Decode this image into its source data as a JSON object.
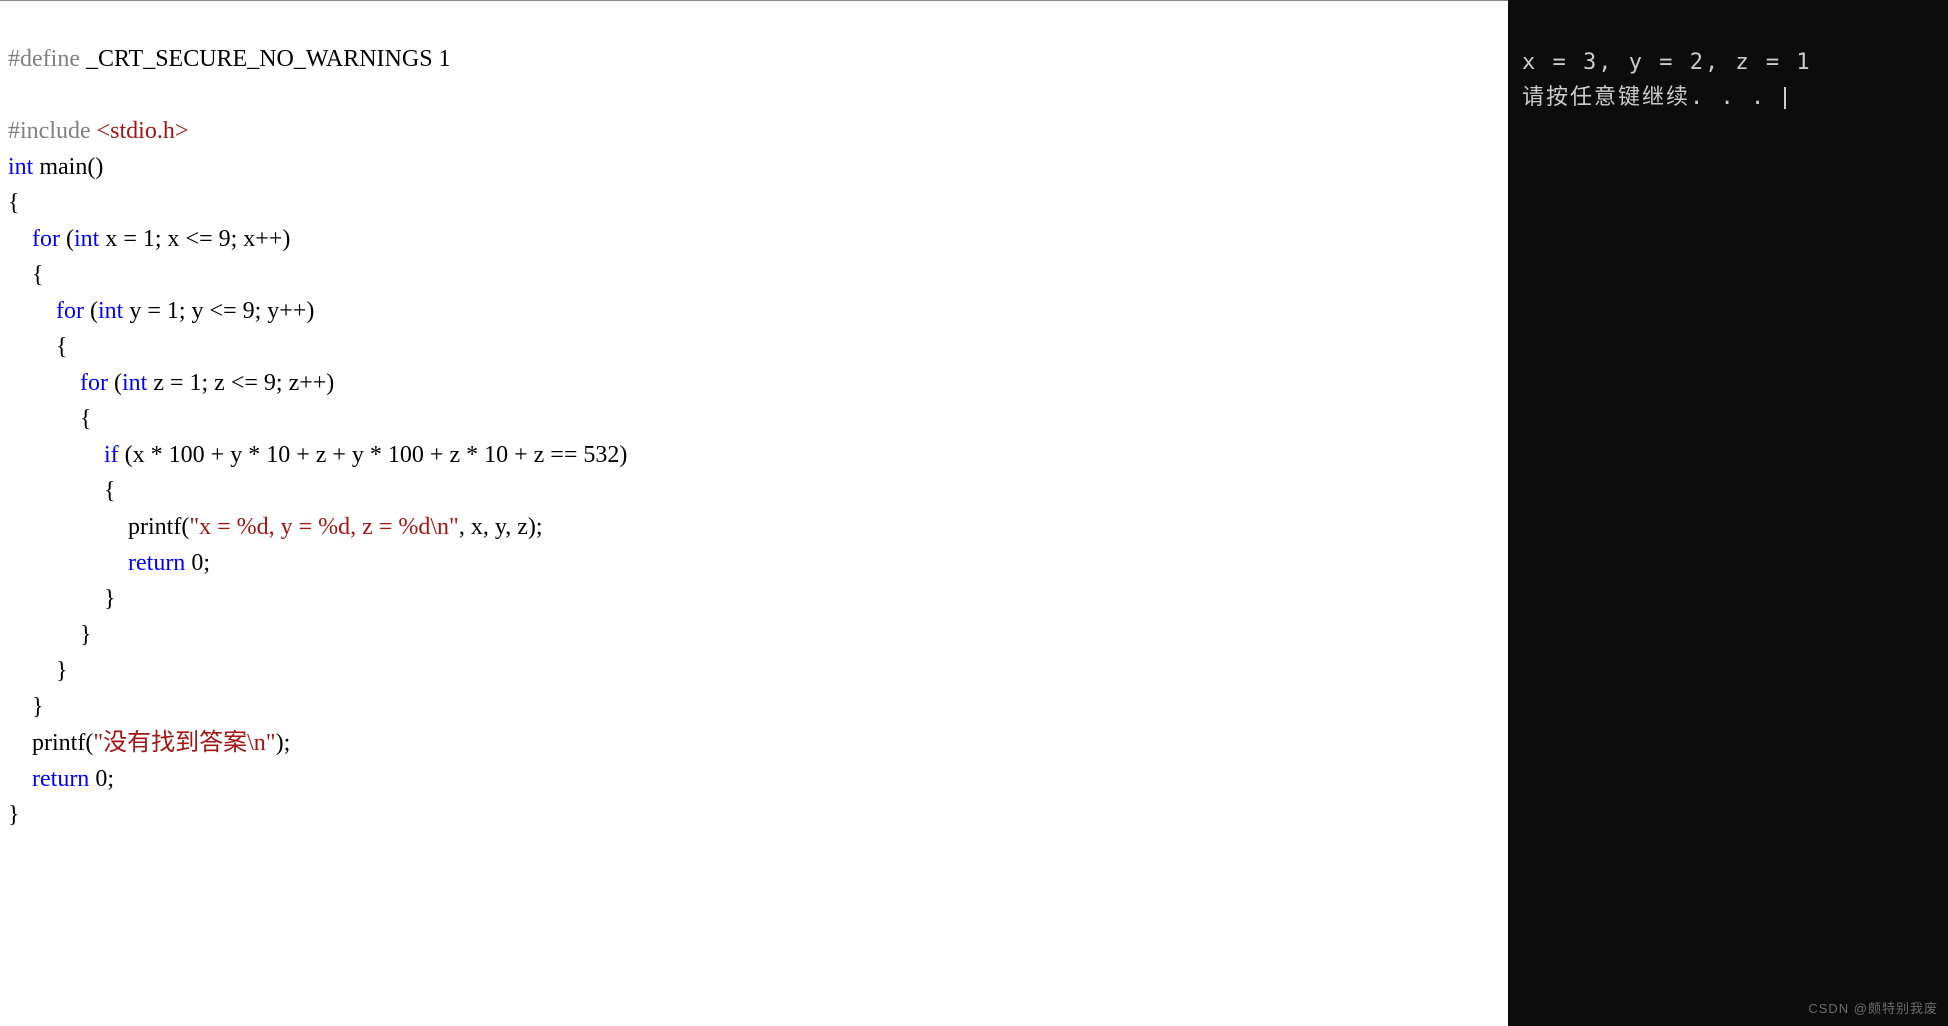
{
  "editor": {
    "line1_prefix": "#define",
    "line1_rest": " _CRT_SECURE_NO_WARNINGS 1",
    "line3a": "#include",
    "line3b": " <stdio.h>",
    "line4_int": "int",
    "line4_main": " main()",
    "line5": "{",
    "line7_for": "    for",
    "line7_paren": " (",
    "line7_int": "int",
    "line7_rest": " x = 1; x <= 9; x++)",
    "line8": "    {",
    "line9_for": "        for",
    "line9_paren": " (",
    "line9_int": "int",
    "line9_rest": " y = 1; y <= 9; y++)",
    "line10": "        {",
    "line11_for": "            for",
    "line11_paren": " (",
    "line11_int": "int",
    "line11_rest": " z = 1; z <= 9; z++)",
    "line12": "            {",
    "line13_if": "                if",
    "line13_rest": " (x * 100 + y * 10 + z + y * 100 + z * 10 + z == 532)",
    "line14": "                {",
    "line15_indent": "                    printf(",
    "line15_str": "\"x = %d, y = %d, z = %d\\n\"",
    "line15_rest": ", x, y, z);",
    "line16_indent": "                    ",
    "line16_return": "return",
    "line16_rest": " 0;",
    "line17": "                }",
    "line18": "            }",
    "line19": "        }",
    "line20": "    }",
    "line21_indent": "    printf(",
    "line21_str": "\"没有找到答案\\n\"",
    "line21_rest": ");",
    "line22_indent": "    ",
    "line22_return": "return",
    "line22_rest": " 0;",
    "line23": "}"
  },
  "console": {
    "line1": "x = 3, y = 2, z = 1",
    "line2": "请按任意键继续. . . "
  },
  "watermark": "CSDN @颇特别我废"
}
